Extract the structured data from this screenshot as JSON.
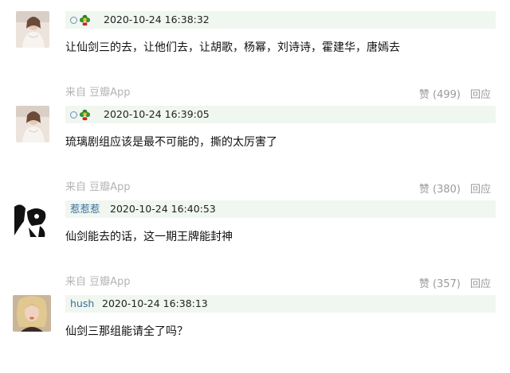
{
  "comments": [
    {
      "username": "",
      "time": "2020-10-24 16:38:32",
      "text": "让仙剑三的去，让他们去，让胡歌，杨幂，刘诗诗，霍建华，唐嫣去",
      "source": "来自 豆瓣App",
      "likes": "赞 (499)",
      "reply": "回应",
      "badge_icon": "flower-badge-icon"
    },
    {
      "username": "",
      "time": "2020-10-24 16:39:05",
      "text": "琉璃剧组应该是最不可能的，撕的太厉害了",
      "source": "来自 豆瓣App",
      "likes": "赞 (380)",
      "reply": "回应",
      "badge_icon": "flower-badge-icon"
    },
    {
      "username": "惹惹惹",
      "time": "2020-10-24 16:40:53",
      "text": "仙剑能去的话，这一期王牌能封神",
      "source": "来自 豆瓣App",
      "likes": "赞 (357)",
      "reply": "回应"
    },
    {
      "username": "hush",
      "time": "2020-10-24 16:38:13",
      "text": "仙剑三那组能请全了吗？",
      "source": "",
      "likes": "",
      "reply": ""
    }
  ],
  "colors": {
    "meta_bg": "#f0f6f0",
    "username": "#3a6f9a",
    "muted": "#b4b4b4",
    "action": "#9a9a9a"
  }
}
